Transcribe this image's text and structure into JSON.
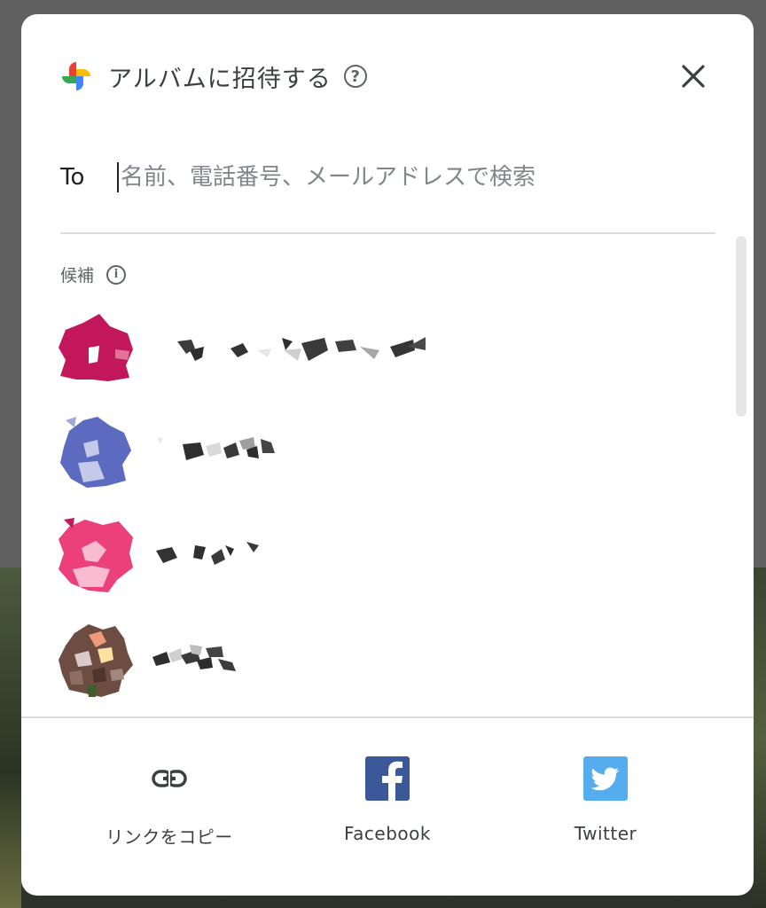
{
  "dialog": {
    "title": "アルバムに招待する",
    "help_icon": "help-circle-icon",
    "close_icon": "close-icon"
  },
  "to_field": {
    "label": "To",
    "placeholder": "名前、電話番号、メールアドレスで検索",
    "value": ""
  },
  "suggestions": {
    "label": "候補",
    "info_icon": "info-icon",
    "contacts": [
      {
        "avatar_color": "#c2185b",
        "name_redacted": true
      },
      {
        "avatar_color": "#5c6bc0",
        "name_redacted": true
      },
      {
        "avatar_color": "#ec407a",
        "name_redacted": true
      },
      {
        "avatar_color": "#6d4c41",
        "name_redacted": true
      }
    ]
  },
  "share_options": [
    {
      "label": "リンクをコピー",
      "icon": "link-icon"
    },
    {
      "label": "Facebook",
      "icon": "facebook-icon",
      "color": "#3b5998"
    },
    {
      "label": "Twitter",
      "icon": "twitter-icon",
      "color": "#55acee"
    }
  ]
}
